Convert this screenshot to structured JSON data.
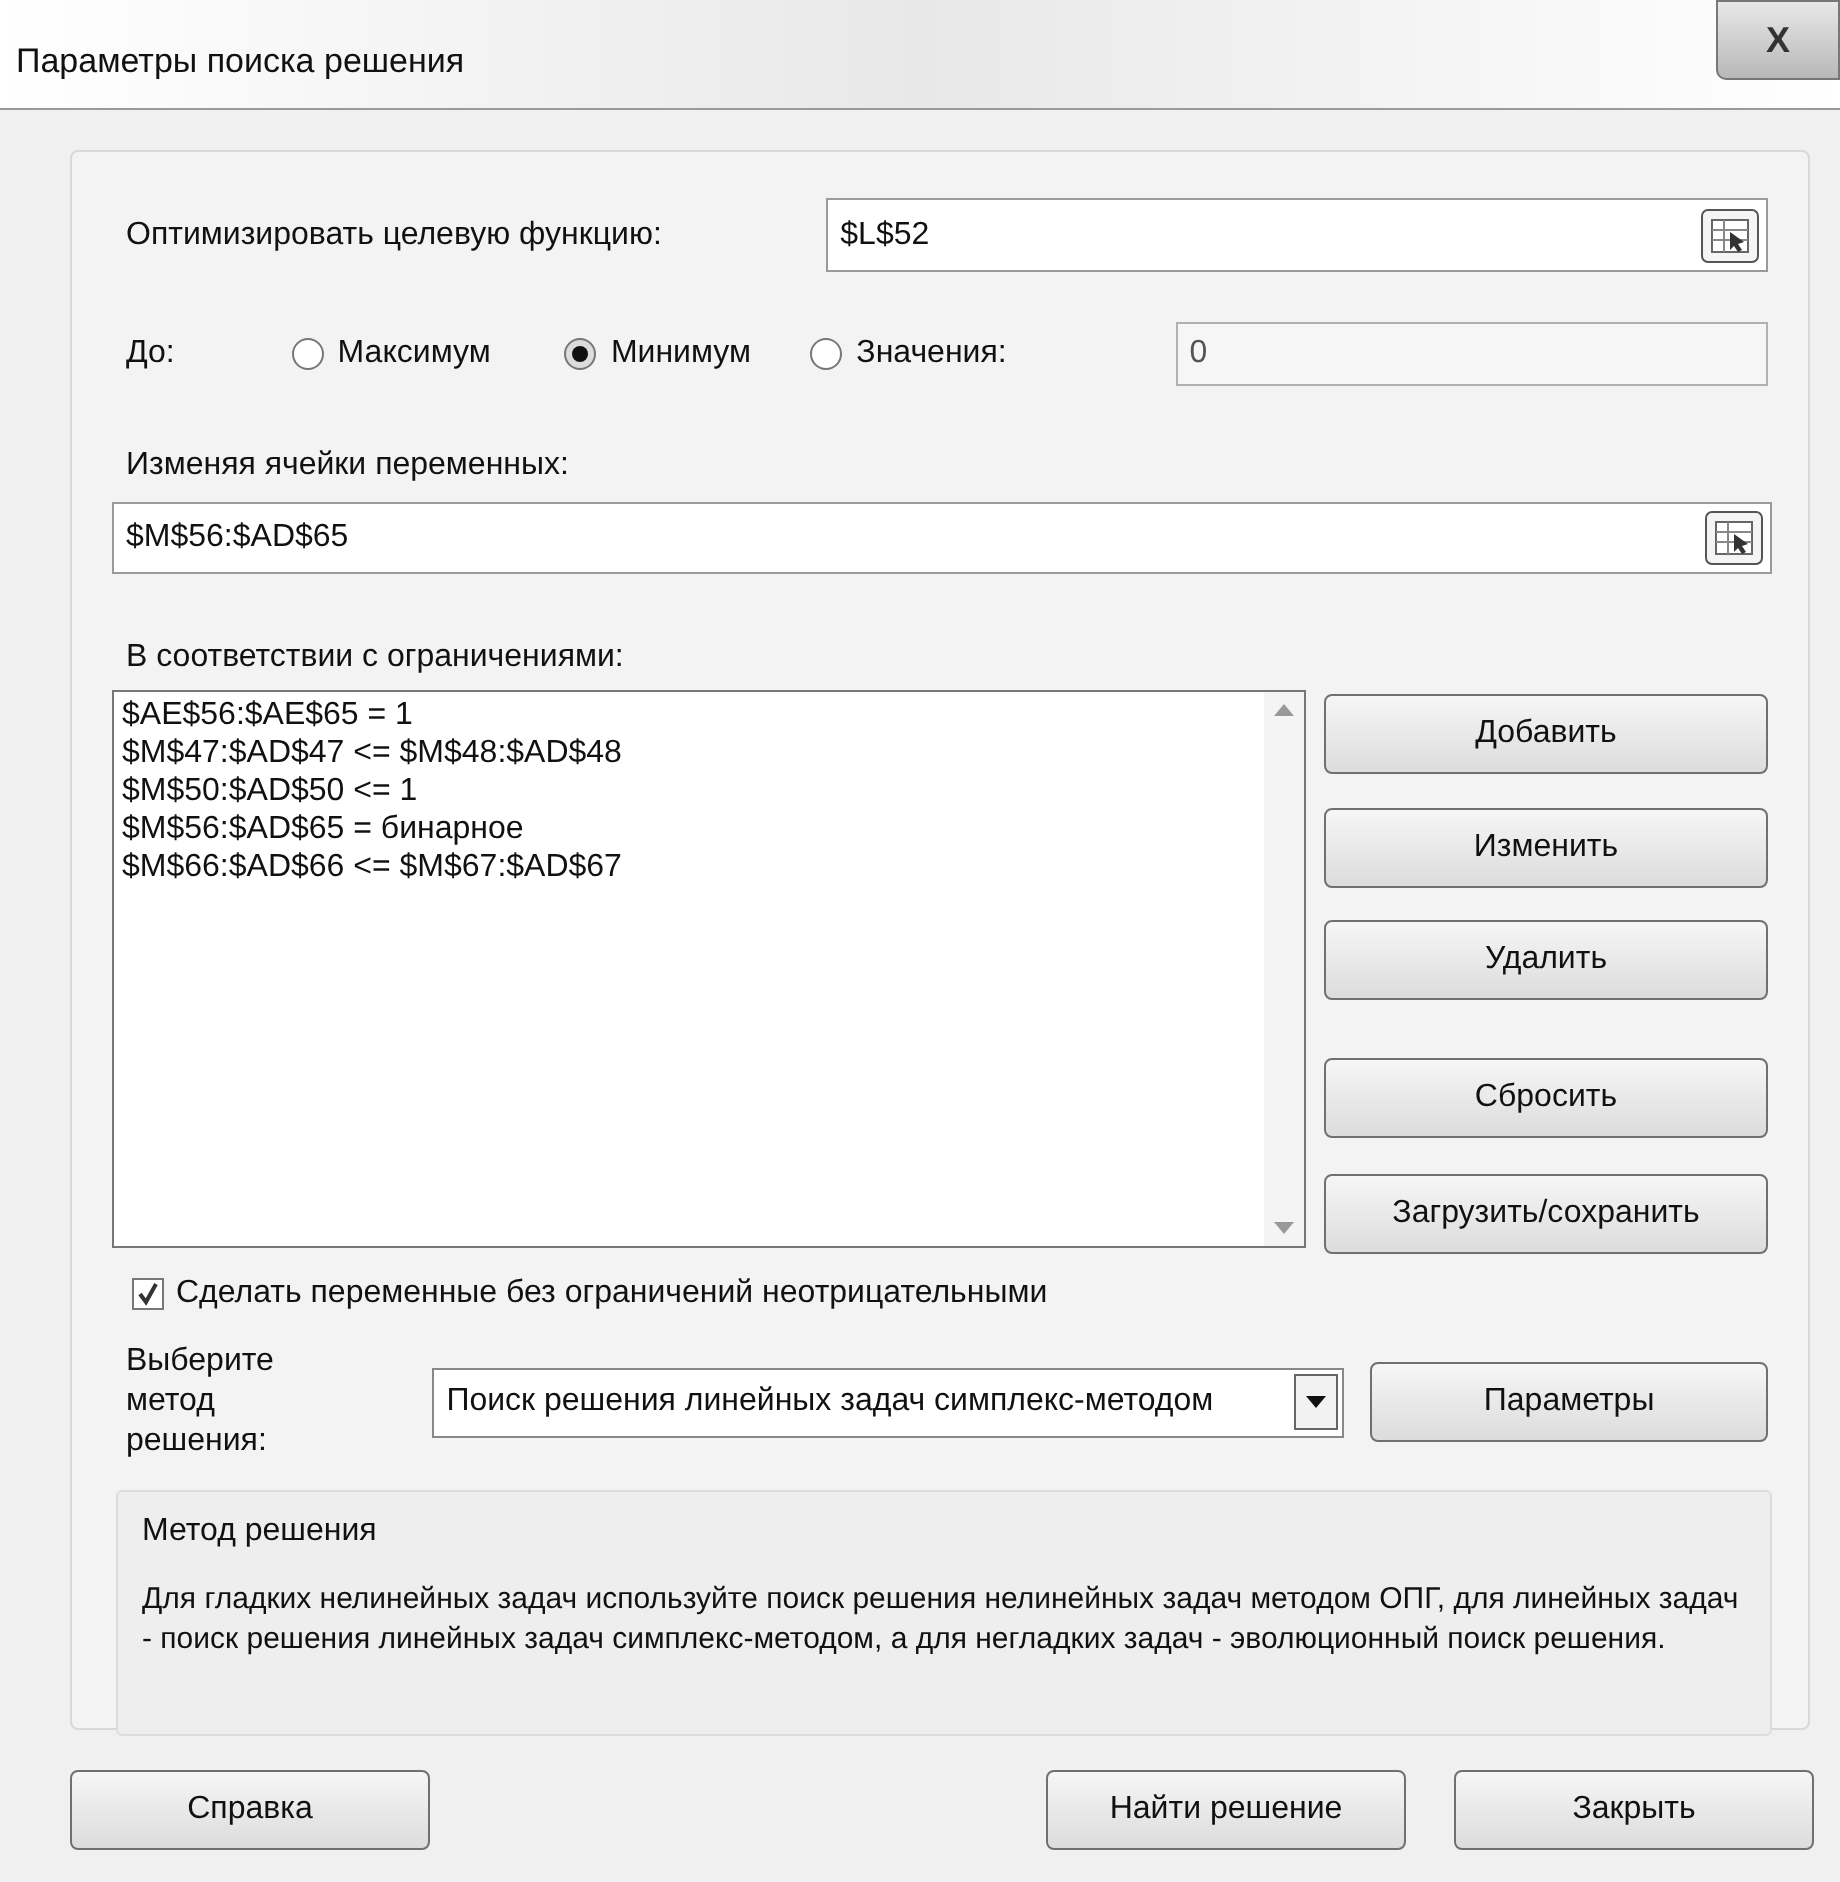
{
  "window": {
    "title": "Параметры поиска решения",
    "close_label": "X"
  },
  "objective": {
    "label": "Оптимизировать целевую функцию:",
    "value": "$L$52"
  },
  "target": {
    "label": "До:",
    "options": [
      {
        "label": "Максимум",
        "selected": false
      },
      {
        "label": "Минимум",
        "selected": true
      },
      {
        "label": "Значения:",
        "selected": false
      }
    ],
    "value": "0"
  },
  "variables": {
    "label": "Изменяя ячейки переменных:",
    "value": "$M$56:$AD$65"
  },
  "constraints": {
    "label": "В соответствии с ограничениями:",
    "items": [
      "$AE$56:$AE$65 = 1",
      "$M$47:$AD$47 <= $M$48:$AD$48",
      "$M$50:$AD$50 <= 1",
      "$M$56:$AD$65 = бинарное",
      "$M$66:$AD$66 <= $M$67:$AD$67"
    ],
    "buttons": [
      "Добавить",
      "Изменить",
      "Удалить",
      "Сбросить",
      "Загрузить/сохранить"
    ]
  },
  "nonnegative": {
    "label": "Сделать переменные без ограничений неотрицательными",
    "checked": true
  },
  "method": {
    "label": "Выберите метод решения:",
    "value": "Поиск решения линейных задач симплекс-методом",
    "button": "Параметры"
  },
  "description": {
    "title": "Метод решения",
    "text": "Для гладких нелинейных задач используйте поиск решения нелинейных задач методом ОПГ, для линейных задач - поиск решения линейных задач симплекс-методом, а для негладких задач - эволюционный поиск решения."
  },
  "footer": {
    "help": "Справка",
    "solve": "Найти решение",
    "close": "Закрыть"
  }
}
